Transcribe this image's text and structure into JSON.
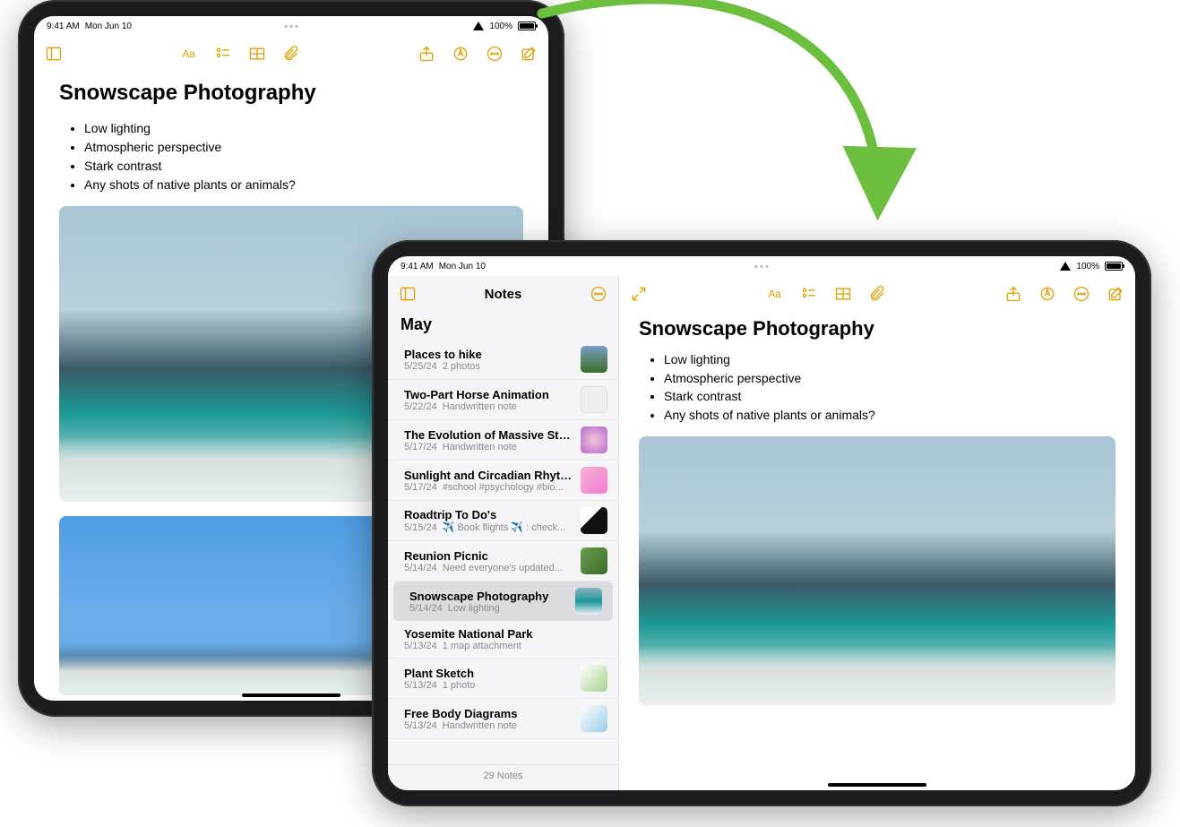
{
  "status": {
    "time": "9:41 AM",
    "date": "Mon Jun 10",
    "battery_pct": "100%"
  },
  "note": {
    "title": "Snowscape Photography",
    "bullets": [
      "Low lighting",
      "Atmospheric perspective",
      "Stark contrast",
      "Any shots of native plants or animals?"
    ]
  },
  "sidebar": {
    "title": "Notes",
    "section": "May",
    "footer": "29 Notes",
    "items": [
      {
        "title": "Places to hike",
        "date": "5/25/24",
        "sub": "2 photos",
        "thumb": "hike"
      },
      {
        "title": "Two-Part Horse Animation",
        "date": "5/22/24",
        "sub": "Handwritten note",
        "thumb": "empty"
      },
      {
        "title": "The Evolution of Massive Star...",
        "date": "5/17/24",
        "sub": "Handwritten note",
        "thumb": "star"
      },
      {
        "title": "Sunlight and Circadian Rhyth...",
        "date": "5/17/24",
        "sub": "#school #psychology #bio...",
        "thumb": "sun"
      },
      {
        "title": "Roadtrip To Do's",
        "date": "5/15/24",
        "sub": "✈️ Book flights ✈️ : check...",
        "thumb": "roadtrip"
      },
      {
        "title": "Reunion Picnic",
        "date": "5/14/24",
        "sub": "Need everyone's updated...",
        "thumb": "reunion"
      },
      {
        "title": "Snowscape Photography",
        "date": "5/14/24",
        "sub": "Low lighting",
        "thumb": "photo-t",
        "selected": true
      },
      {
        "title": "Yosemite National Park",
        "date": "5/13/24",
        "sub": "1 map attachment",
        "thumb": ""
      },
      {
        "title": "Plant Sketch",
        "date": "5/13/24",
        "sub": "1 photo",
        "thumb": "sketch"
      },
      {
        "title": "Free Body Diagrams",
        "date": "5/13/24",
        "sub": "Handwritten note",
        "thumb": "diag"
      }
    ]
  }
}
